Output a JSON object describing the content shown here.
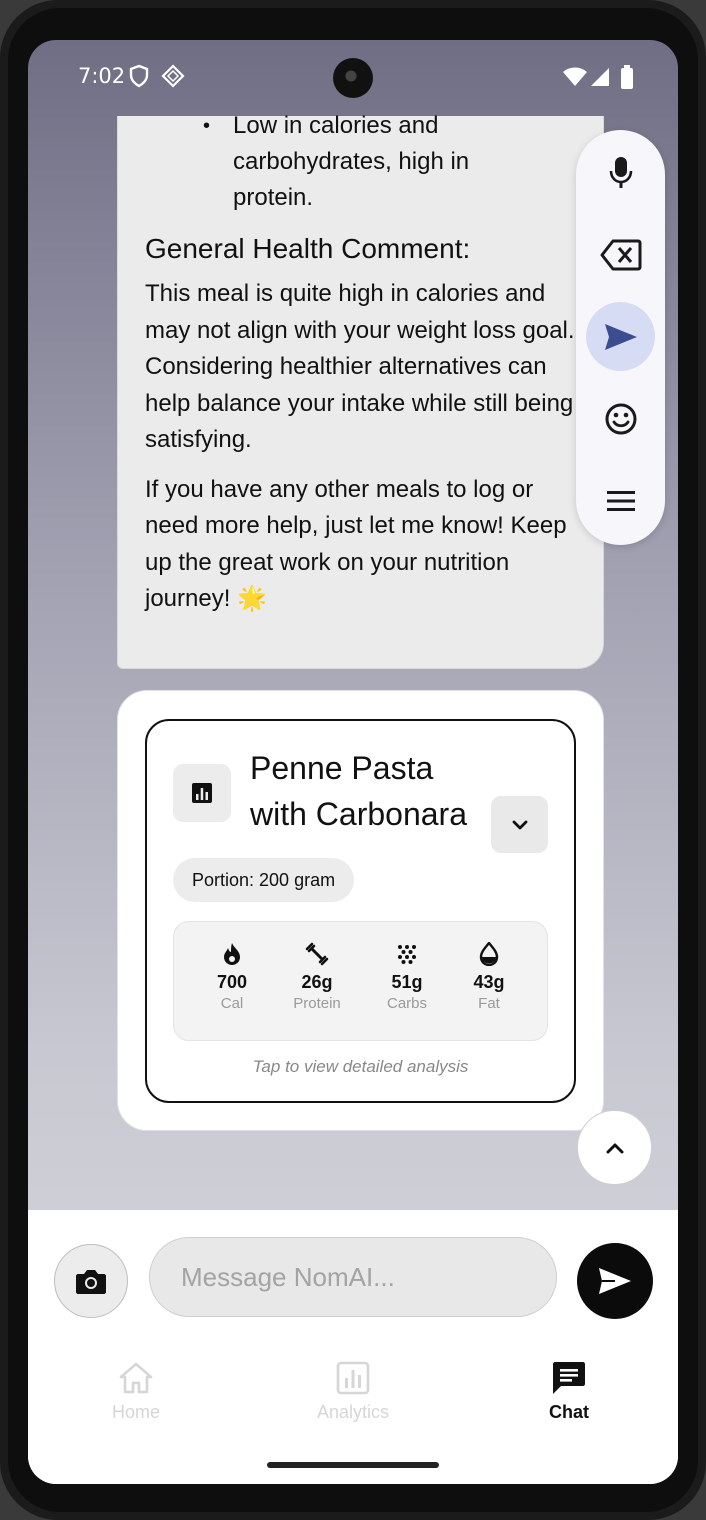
{
  "status_bar": {
    "time": "7:02"
  },
  "chat": {
    "bullet_lines": [
      "Low in calories and",
      "carbohydrates, high in",
      "protein."
    ],
    "heading": "General Health Comment:",
    "paragraph_1": "This meal is quite high in calories and may not align with your weight loss goal. Considering healthier alternatives can help balance your intake while still being satisfying.",
    "paragraph_2": "If you have any other meals to log or need more help, just let me know! Keep up the great work on your nutrition journey! 🌟"
  },
  "keyboard_toolbar": {
    "icons": [
      "mic-icon",
      "backspace-icon",
      "send-icon",
      "emoji-icon",
      "menu-icon"
    ]
  },
  "food_card": {
    "name_line_1": "Penne Pasta",
    "name_line_2": "with Carbonara",
    "portion": "Portion: 200 gram",
    "macros": [
      {
        "icon": "flame-icon",
        "value": "700",
        "label": "Cal"
      },
      {
        "icon": "dumbbell-icon",
        "value": "26g",
        "label": "Protein"
      },
      {
        "icon": "grain-icon",
        "value": "51g",
        "label": "Carbs"
      },
      {
        "icon": "drop-icon",
        "value": "43g",
        "label": "Fat"
      }
    ],
    "hint": "Tap to view detailed analysis"
  },
  "composer": {
    "placeholder": "Message NomAI..."
  },
  "nav": {
    "items": [
      {
        "label": "Home",
        "active": false
      },
      {
        "label": "Analytics",
        "active": false
      },
      {
        "label": "Chat",
        "active": true
      }
    ]
  },
  "colors": {
    "accent_active_nav": "#111111",
    "inactive_nav": "#d6d6d6",
    "send_highlight": "#d7dcf5"
  }
}
